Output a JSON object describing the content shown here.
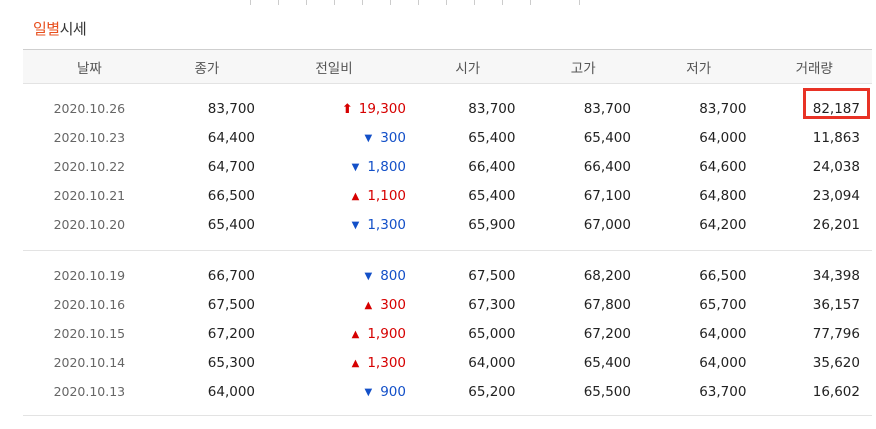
{
  "section": {
    "title_accent": "일별",
    "title_rest": "시세"
  },
  "columns": [
    "날짜",
    "종가",
    "전일비",
    "시가",
    "고가",
    "저가",
    "거래량"
  ],
  "groups": [
    [
      {
        "date": "2020.10.26",
        "close": "83,700",
        "dir": "upper",
        "diff": "19,300",
        "open": "83,700",
        "high": "83,700",
        "low": "83,700",
        "volume": "82,187"
      },
      {
        "date": "2020.10.23",
        "close": "64,400",
        "dir": "down",
        "diff": "300",
        "open": "65,400",
        "high": "65,400",
        "low": "64,000",
        "volume": "11,863"
      },
      {
        "date": "2020.10.22",
        "close": "64,700",
        "dir": "down",
        "diff": "1,800",
        "open": "66,400",
        "high": "66,400",
        "low": "64,600",
        "volume": "24,038"
      },
      {
        "date": "2020.10.21",
        "close": "66,500",
        "dir": "up",
        "diff": "1,100",
        "open": "65,400",
        "high": "67,100",
        "low": "64,800",
        "volume": "23,094"
      },
      {
        "date": "2020.10.20",
        "close": "65,400",
        "dir": "down",
        "diff": "1,300",
        "open": "65,900",
        "high": "67,000",
        "low": "64,200",
        "volume": "26,201"
      }
    ],
    [
      {
        "date": "2020.10.19",
        "close": "66,700",
        "dir": "down",
        "diff": "800",
        "open": "67,500",
        "high": "68,200",
        "low": "66,500",
        "volume": "34,398"
      },
      {
        "date": "2020.10.16",
        "close": "67,500",
        "dir": "up",
        "diff": "300",
        "open": "67,300",
        "high": "67,800",
        "low": "65,700",
        "volume": "36,157"
      },
      {
        "date": "2020.10.15",
        "close": "67,200",
        "dir": "up",
        "diff": "1,900",
        "open": "65,000",
        "high": "67,200",
        "low": "64,000",
        "volume": "77,796"
      },
      {
        "date": "2020.10.14",
        "close": "65,300",
        "dir": "up",
        "diff": "1,300",
        "open": "64,000",
        "high": "65,400",
        "low": "64,000",
        "volume": "35,620"
      },
      {
        "date": "2020.10.13",
        "close": "64,000",
        "dir": "down",
        "diff": "900",
        "open": "65,200",
        "high": "65,500",
        "low": "63,700",
        "volume": "16,602"
      }
    ]
  ],
  "icons": {
    "upper": "upper-limit-arrow-icon",
    "up": "up-triangle-icon",
    "down": "down-triangle-icon"
  },
  "colors": {
    "up": "#d60000",
    "down": "#1350c8",
    "accent": "#e8501f",
    "highlight": "#e83225"
  }
}
